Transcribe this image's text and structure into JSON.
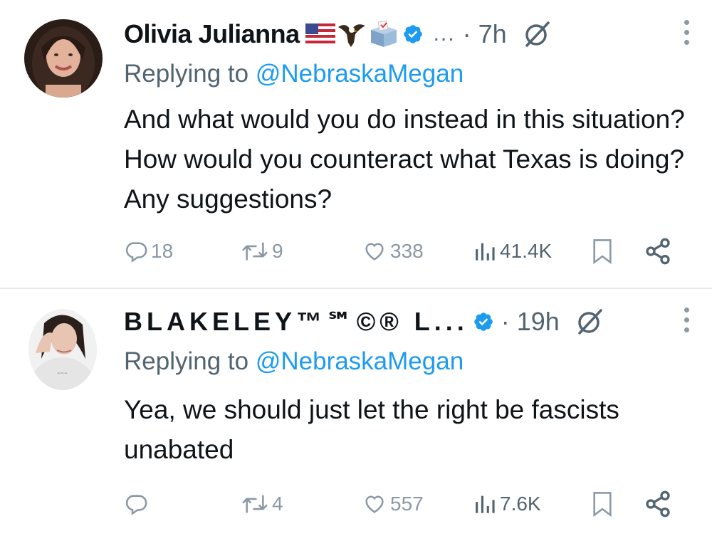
{
  "tweets": [
    {
      "name": "Olivia Julianna",
      "emoji_flags": [
        "us-flag-icon",
        "eagle-icon",
        "ballot-box-icon"
      ],
      "overflow": "...",
      "time": "· 7h",
      "reply_prefix": "Replying to ",
      "reply_handle": "@NebraskaMegan",
      "text": "And what would you do instead in this situation? How would you counteract what Texas is doing? Any suggestions?",
      "replies": "18",
      "retweets": "9",
      "likes": "338",
      "views": "41.4K"
    },
    {
      "name": "BLAKELEY™℠©® L...",
      "time": "· 19h",
      "reply_prefix": "Replying to ",
      "reply_handle": "@NebraskaMegan",
      "text": "Yea, we should just let the right be fascists unabated",
      "replies": "",
      "retweets": "4",
      "likes": "557",
      "views": "7.6K"
    }
  ],
  "colors": {
    "text": "#0f1419",
    "secondary": "#536471",
    "icon": "#8b98a5",
    "link": "#1d9bf0",
    "verified": "#1d9bf0",
    "divider": "#e6e9ec"
  }
}
